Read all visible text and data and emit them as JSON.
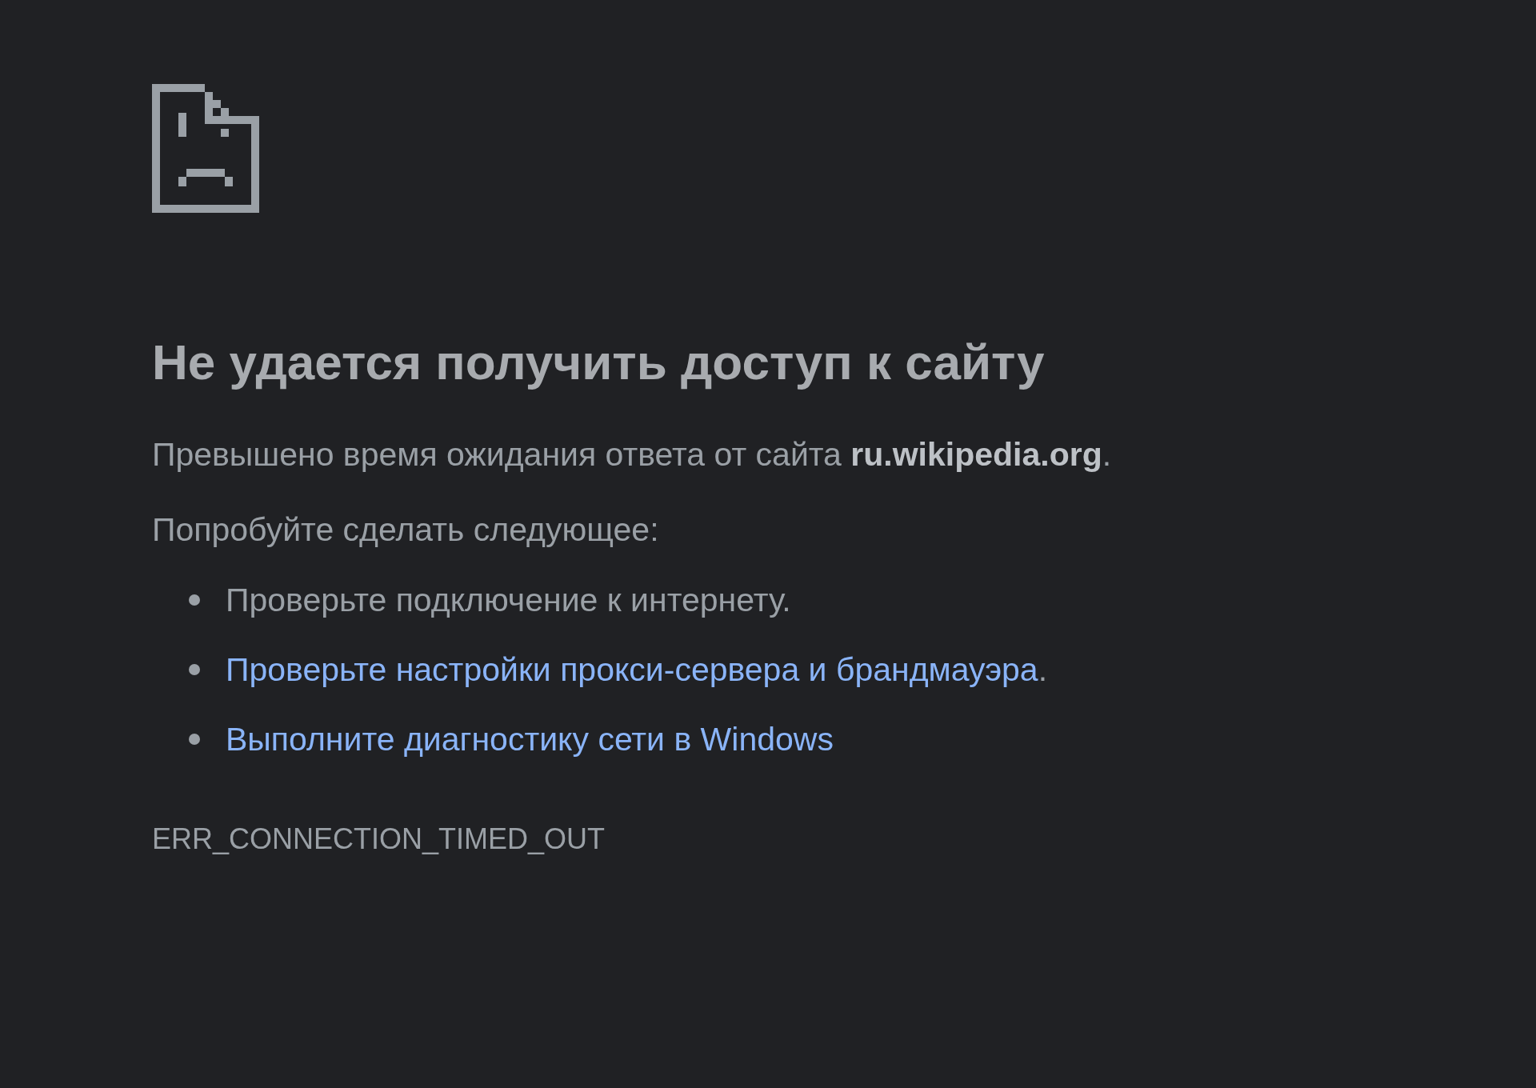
{
  "heading": "Не удается получить доступ к сайту",
  "message": "Превышено время ожидания ответа от сайта **ru.wikipedia.org**.",
  "suggestions_intro": "Попробуйте сделать следующее:",
  "suggestions": [
    {
      "kind": "text",
      "text": "Проверьте подключение к интернету."
    },
    {
      "kind": "link",
      "text": "Проверьте настройки прокси-сервера и брандмауэра",
      "suffix": "."
    },
    {
      "kind": "link",
      "text": "Выполните диагностику сети в Windows"
    }
  ],
  "error_code": "ERR_CONNECTION_TIMED_OUT"
}
